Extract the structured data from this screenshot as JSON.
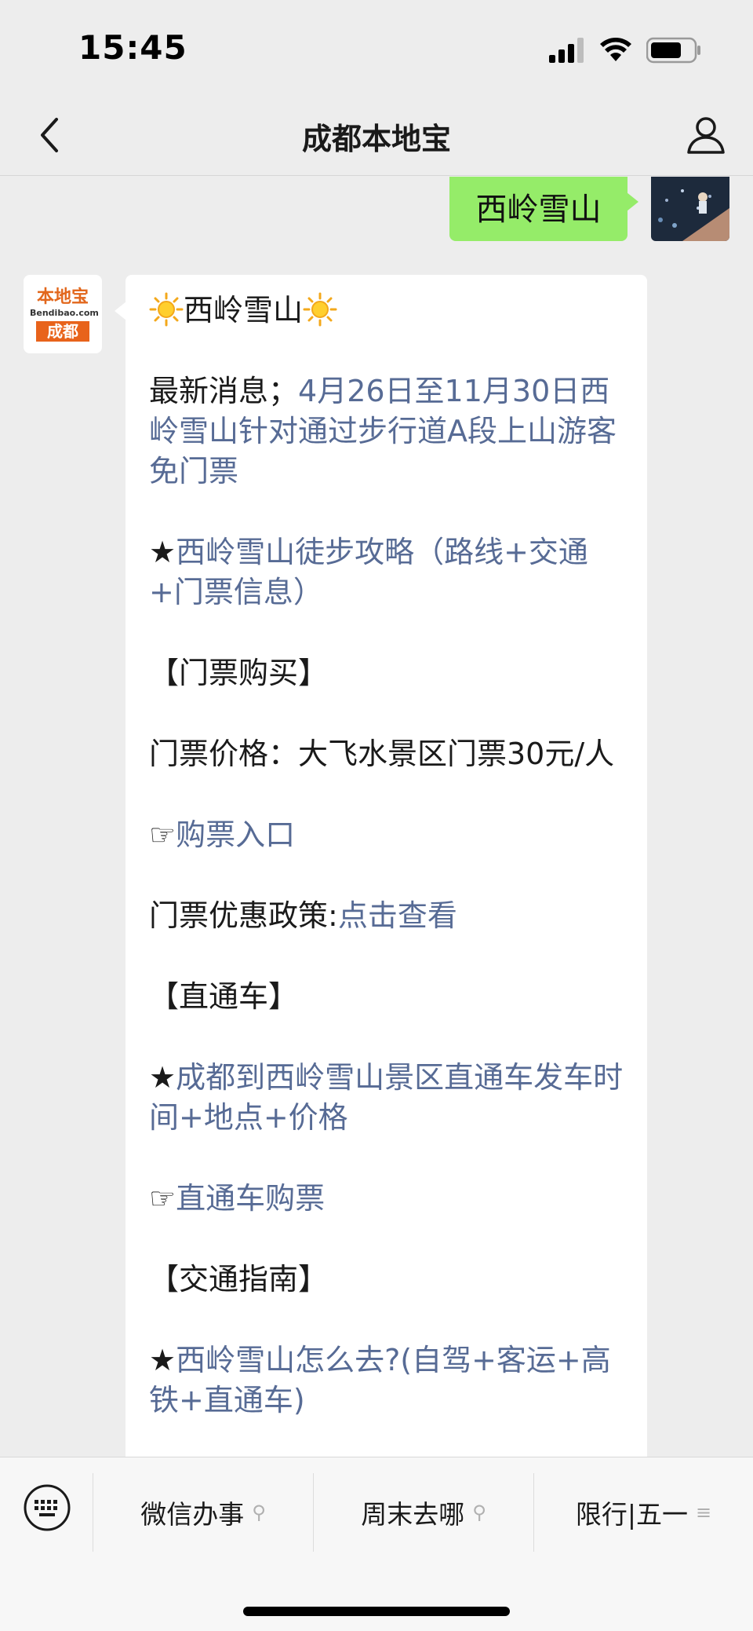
{
  "status_bar": {
    "time": "15:45"
  },
  "nav": {
    "title": "成都本地宝"
  },
  "outgoing_message": {
    "text": "西岭雪山"
  },
  "incoming_avatar": {
    "logo_top": "本地宝",
    "logo_mid": "Bendibao.com",
    "logo_bottom": "成都"
  },
  "incoming_message": {
    "title": "西岭雪山",
    "news_prefix": "最新消息；",
    "news_link": "4月26日至11月30日西岭雪山针对通过步行道A段上山游客免门票",
    "guide_star": "★",
    "guide_link": "西岭雪山徒步攻略（路线+交通+门票信息）",
    "ticket_heading": "【门票购买】",
    "ticket_price": "门票价格：大飞水景区门票30元/人",
    "buy_hand": "☞",
    "buy_link": "购票入口",
    "discount_prefix": "门票优惠政策:",
    "discount_link": "点击查看",
    "bus_heading": "【直通车】",
    "bus_star": "★",
    "bus_link": "成都到西岭雪山景区直通车发车时间+地点+价格",
    "bus_hand": "☞",
    "bus_buy_link": "直通车购票",
    "traffic_heading": "【交通指南】",
    "traffic_star": "★",
    "traffic_link": "西岭雪山怎么去?(自驾+客运+高铁+直通车)"
  },
  "bottom_menu": {
    "items": [
      "微信办事",
      "周末去哪",
      "限行|五一"
    ]
  },
  "colors": {
    "link": "#576b95",
    "outgoing_bubble": "#95ec69",
    "brand_orange": "#e8631b"
  }
}
